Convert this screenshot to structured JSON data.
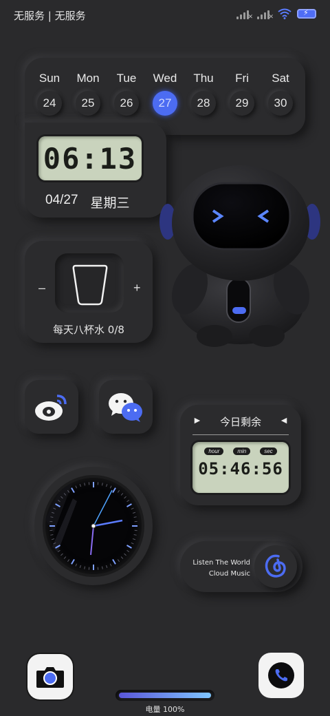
{
  "status_bar": {
    "carrier": "无服务 | 无服务",
    "icons": [
      "signal-no-service-icon",
      "signal-no-service-icon",
      "wifi-icon",
      "battery-charging-icon"
    ]
  },
  "calendar": {
    "weekdays": [
      "Sun",
      "Mon",
      "Tue",
      "Wed",
      "Thu",
      "Fri",
      "Sat"
    ],
    "dates": [
      "24",
      "25",
      "26",
      "27",
      "28",
      "29",
      "30"
    ],
    "today": "27",
    "accent": "#4c6cf2"
  },
  "clock": {
    "time": "06:13",
    "date": "04/27",
    "weekday": "星期三"
  },
  "water": {
    "minus": "–",
    "plus": "+",
    "label": "每天八杯水 0/8"
  },
  "apps": {
    "weibo": "weibo-icon",
    "wechat": "wechat-icon",
    "camera": "camera-icon",
    "phone": "phone-icon"
  },
  "countdown": {
    "left_arrow": "►",
    "title": "今日剩余",
    "right_arrow": "◄",
    "tags": {
      "hour": "hour",
      "min": "min",
      "sec": "sec"
    },
    "time": "05:46:56"
  },
  "music": {
    "line1": "Listen The World",
    "line2": "Cloud Music",
    "icon": "netease-cloud-music-icon"
  },
  "battery": {
    "label": "电量 100%",
    "level": 1.0
  }
}
